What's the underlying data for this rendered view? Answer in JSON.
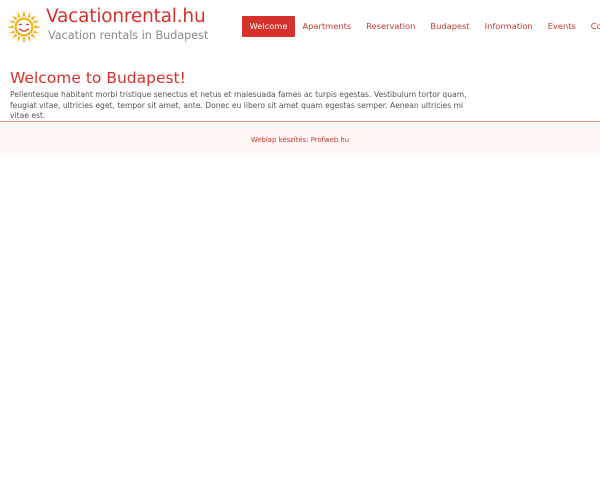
{
  "header": {
    "site_title": "Vacationrental.hu",
    "subtitle": "Vacation rentals in Budapest",
    "logo_icon": "sun-icon",
    "brand_color": "#d6322b",
    "sun_color": "#f2b21c"
  },
  "nav": {
    "items": [
      {
        "label": "Welcome",
        "active": true
      },
      {
        "label": "Apartments",
        "active": false
      },
      {
        "label": "Reservation",
        "active": false
      },
      {
        "label": "Budapest",
        "active": false
      },
      {
        "label": "Information",
        "active": false
      },
      {
        "label": "Events",
        "active": false
      },
      {
        "label": "Contact",
        "active": false
      }
    ]
  },
  "main": {
    "title": "Welcome to Budapest!",
    "text": "Pellentesque habitant morbi tristique senectus et netus et malesuada fames ac turpis egestas. Vestibulum tortor quam, feugiat vitae, ultricies eget, tempor sit amet, ante. Donec eu libero sit amet quam egestas semper. Aenean ultricies mi vitae est."
  },
  "footer": {
    "credit": "Weblap készítés: Profweb.hu"
  }
}
